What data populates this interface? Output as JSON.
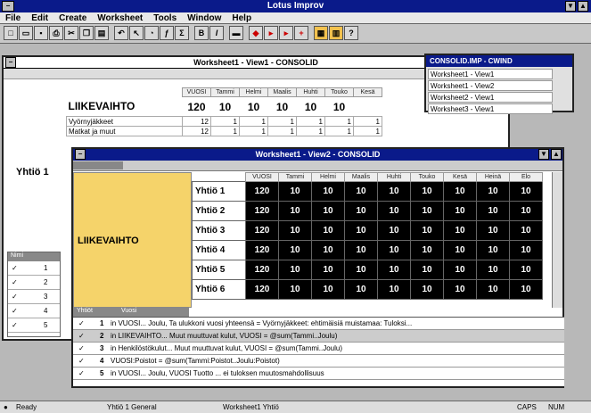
{
  "app": {
    "title": "Lotus Improv"
  },
  "menu": [
    "File",
    "Edit",
    "Create",
    "Worksheet",
    "Tools",
    "Window",
    "Help"
  ],
  "view1": {
    "title": "Worksheet1 - View1 - CONSOLID",
    "cols": [
      "VUOSI",
      "Tammi",
      "Helmi",
      "Maalis",
      "Huhti",
      "Touko",
      "Kesä"
    ],
    "big_row": {
      "label": "LIIKEVAIHTO",
      "values": [
        "120",
        "10",
        "10",
        "10",
        "10",
        "10"
      ]
    },
    "rows": [
      {
        "label": "Vyörnyjäkkeet",
        "values": [
          "12",
          "1",
          "1",
          "1",
          "1",
          "1",
          "1"
        ]
      },
      {
        "label": "Matkat ja muut",
        "values": [
          "12",
          "1",
          "1",
          "1",
          "1",
          "1",
          "1"
        ]
      }
    ],
    "side_label": "Yhtiö 1"
  },
  "consol": {
    "title": "CONSOLID.IMP - CWIND",
    "items": [
      "Worksheet1 - View1",
      "Worksheet1 - View2",
      "Worksheet2 - View1",
      "Worksheet3 - View1"
    ]
  },
  "view2": {
    "title": "Worksheet1 - View2 - CONSOLID",
    "cols": [
      "VUOSI",
      "Tammi",
      "Helmi",
      "Maalis",
      "Huhti",
      "Touko",
      "Kesä",
      "Heinä",
      "Elo"
    ],
    "group_label": "LIIKEVAIHTO",
    "rows": [
      {
        "label": "Yhtiö 1",
        "values": [
          "120",
          "10",
          "10",
          "10",
          "10",
          "10",
          "10",
          "10",
          "10"
        ]
      },
      {
        "label": "Yhtiö 2",
        "values": [
          "120",
          "10",
          "10",
          "10",
          "10",
          "10",
          "10",
          "10",
          "10"
        ]
      },
      {
        "label": "Yhtiö 3",
        "values": [
          "120",
          "10",
          "10",
          "10",
          "10",
          "10",
          "10",
          "10",
          "10"
        ]
      },
      {
        "label": "Yhtiö 4",
        "values": [
          "120",
          "10",
          "10",
          "10",
          "10",
          "10",
          "10",
          "10",
          "10"
        ]
      },
      {
        "label": "Yhtiö 5",
        "values": [
          "120",
          "10",
          "10",
          "10",
          "10",
          "10",
          "10",
          "10",
          "10"
        ]
      },
      {
        "label": "Yhtiö 6",
        "values": [
          "120",
          "10",
          "10",
          "10",
          "10",
          "10",
          "10",
          "10",
          "10"
        ]
      }
    ],
    "tabs": [
      "Yhtiöt",
      "Vuosi"
    ]
  },
  "formulas": [
    {
      "n": "1",
      "text": "in VUOSI... Joulu, Ta ulukkoni vuosi yhteensä = Vyörnyjäkkeet: ehtimäisiä muistamaa: Tuloksi..."
    },
    {
      "n": "2",
      "text": "in LIIKEVAIHTO... Muut muuttuvat kulut, VUOSI = @sum(Tammi..Joulu)"
    },
    {
      "n": "3",
      "text": "in Henkilöstökulut... Muut muuttuvat kulut, VUOSI = @sum(Tammi..Joulu)"
    },
    {
      "n": "4",
      "text": "VUOSI:Poistot = @sum(Tammi:Poistot..Joulu:Poistot)"
    },
    {
      "n": "5",
      "text": "in VUOSI... Joulu, VUOSI Tuotto ... ei tuloksen muutosmahdollisuus"
    }
  ],
  "left_panel": {
    "headers": [
      "Nimi"
    ],
    "rows": [
      "1",
      "2",
      "3",
      "4",
      "5"
    ]
  },
  "status": {
    "left": "Ready",
    "mid": "Yhtiö 1 General",
    "right": "Worksheet1 Yhtiö",
    "cap": "CAPS",
    "num": "NUM"
  }
}
